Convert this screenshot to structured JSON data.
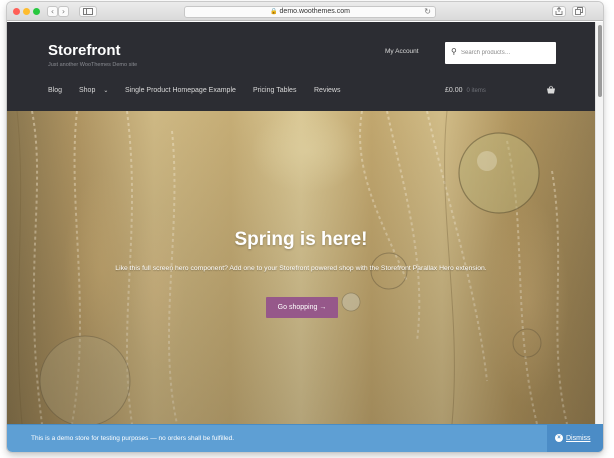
{
  "browser": {
    "url": "demo.woothemes.com",
    "back_glyph": "‹",
    "forward_glyph": "›",
    "lock_glyph": "🔒",
    "reload_glyph": "↻"
  },
  "header": {
    "site_title": "Storefront",
    "tagline": "Just another WooThemes Demo site",
    "my_account": "My Account",
    "search_placeholder": "Search products…",
    "search_icon": "magnifier",
    "search_glyph": "⚲"
  },
  "nav": {
    "items": [
      {
        "label": "Blog"
      },
      {
        "label": "Shop",
        "has_dropdown": true
      },
      {
        "label": "Single Product Homepage Example"
      },
      {
        "label": "Pricing Tables"
      },
      {
        "label": "Reviews"
      }
    ],
    "caret_glyph": "⌄"
  },
  "cart": {
    "amount": "£0.00",
    "items_label": "0 items",
    "icon": "basket"
  },
  "hero": {
    "heading": "Spring is here!",
    "text": "Like this full screen hero component? Add one to your Storefront powered shop with the Storefront Parallax Hero extension.",
    "button_label": "Go shopping →"
  },
  "notice": {
    "message": "This is a demo store for testing purposes — no orders shall be fulfilled.",
    "dismiss_label": "Dismiss",
    "dismiss_glyph": "×"
  },
  "colors": {
    "header_bg": "#2c2d33",
    "accent": "#96588a",
    "notice_bg": "#5e9fd4"
  }
}
